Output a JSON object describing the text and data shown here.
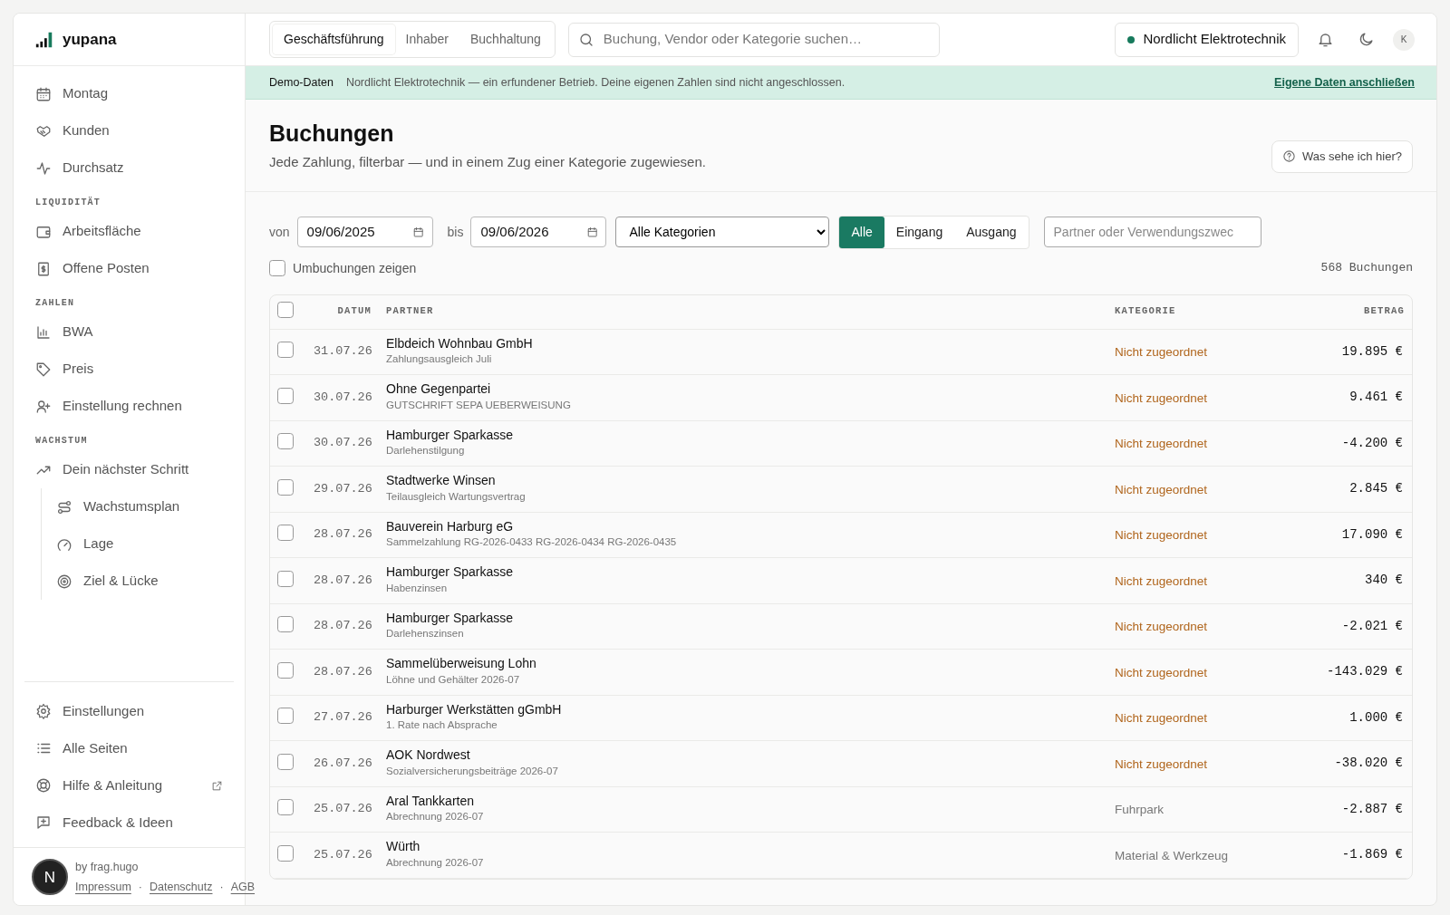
{
  "sidebar": {
    "logo": "yupana",
    "groups": [
      {
        "items": [
          {
            "label": "Montag"
          },
          {
            "label": "Kunden"
          },
          {
            "label": "Durchsatz"
          }
        ]
      },
      {
        "heading": "LIQUIDITÄT",
        "items": [
          {
            "label": "Arbeitsfläche"
          },
          {
            "label": "Offene Posten"
          }
        ]
      },
      {
        "heading": "ZAHLEN",
        "items": [
          {
            "label": "BWA"
          },
          {
            "label": "Preis"
          },
          {
            "label": "Einstellung rechnen"
          }
        ]
      },
      {
        "heading": "WACHSTUM",
        "items": [
          {
            "label": "Dein nächster Schritt",
            "children": [
              {
                "label": "Wachstumsplan"
              },
              {
                "label": "Lage"
              },
              {
                "label": "Ziel & Lücke"
              }
            ]
          }
        ]
      }
    ],
    "bottom_items": [
      {
        "label": "Einstellungen",
        "external": false
      },
      {
        "label": "Alle Seiten",
        "external": false
      },
      {
        "label": "Hilfe & Anleitung",
        "external": true
      },
      {
        "label": "Feedback & Ideen",
        "external": false
      }
    ],
    "credit": "by frag.hugo",
    "links": [
      {
        "label": "Impressum"
      },
      {
        "separator": "·",
        "label": "Datenschutz"
      },
      {
        "separator": "·",
        "label": "AGB"
      }
    ]
  },
  "dev_badge": "N",
  "topbar": {
    "role_tabs": [
      {
        "label": "Geschäftsführung",
        "selected": true
      },
      {
        "label": "Inhaber",
        "selected": false
      },
      {
        "label": "Buchhaltung",
        "selected": false
      }
    ],
    "search": {
      "placeholder": "Buchung, Vendor oder Kategorie suchen…"
    },
    "company": "Nordlicht Elektrotechnik",
    "avatar": "K"
  },
  "banner": {
    "label": "Demo-Daten",
    "text": "Nordlicht Elektrotechnik — ein erfundener Betrieb. Deine eigenen Zahlen sind nicht angeschlossen.",
    "link": "Eigene Daten anschließen"
  },
  "page": {
    "title": "Buchungen",
    "subtitle": "Jede Zahlung, filterbar — und in einem Zug einer Kategorie zugewiesen.",
    "help_button": "Was sehe ich hier?"
  },
  "filters": {
    "from_label": "von",
    "from": "09/06/2025",
    "to_label": "bis",
    "to": "09/06/2026",
    "category": "Alle Kategorien",
    "direction": [
      {
        "label": "Alle",
        "selected": true
      },
      {
        "label": "Eingang",
        "selected": false
      },
      {
        "label": "Ausgang",
        "selected": false
      }
    ],
    "search": {
      "placeholder": "Partner oder Verwendungszwec"
    },
    "show_transfers": {
      "label": "Umbuchungen zeigen",
      "checked": false
    },
    "count": "568 Buchungen"
  },
  "table": {
    "select_all": {
      "checked": false
    },
    "columns": [
      "DATUM",
      "PARTNER",
      "KATEGORIE",
      "BETRAG"
    ],
    "rows": [
      {
        "checked": false,
        "date": "31.07.26",
        "partner": "Elbdeich Wohnbau GmbH",
        "purpose": "Zahlungsausgleich Juli",
        "category": "Nicht zugeordnet",
        "assigned": false,
        "amount": "19.895 €"
      },
      {
        "checked": false,
        "date": "30.07.26",
        "partner": "Ohne Gegenpartei",
        "purpose": "GUTSCHRIFT SEPA UEBERWEISUNG",
        "category": "Nicht zugeordnet",
        "assigned": false,
        "amount": "9.461 €"
      },
      {
        "checked": false,
        "date": "30.07.26",
        "partner": "Hamburger Sparkasse",
        "purpose": "Darlehenstilgung",
        "category": "Nicht zugeordnet",
        "assigned": false,
        "amount": "-4.200 €"
      },
      {
        "checked": false,
        "date": "29.07.26",
        "partner": "Stadtwerke Winsen",
        "purpose": "Teilausgleich Wartungsvertrag",
        "category": "Nicht zugeordnet",
        "assigned": false,
        "amount": "2.845 €"
      },
      {
        "checked": false,
        "date": "28.07.26",
        "partner": "Bauverein Harburg eG",
        "purpose": "Sammelzahlung RG-2026-0433 RG-2026-0434 RG-2026-0435",
        "category": "Nicht zugeordnet",
        "assigned": false,
        "amount": "17.090 €"
      },
      {
        "checked": false,
        "date": "28.07.26",
        "partner": "Hamburger Sparkasse",
        "purpose": "Habenzinsen",
        "category": "Nicht zugeordnet",
        "assigned": false,
        "amount": "340 €"
      },
      {
        "checked": false,
        "date": "28.07.26",
        "partner": "Hamburger Sparkasse",
        "purpose": "Darlehenszinsen",
        "category": "Nicht zugeordnet",
        "assigned": false,
        "amount": "-2.021 €"
      },
      {
        "checked": false,
        "date": "28.07.26",
        "partner": "Sammelüberweisung Lohn",
        "purpose": "Löhne und Gehälter 2026-07",
        "category": "Nicht zugeordnet",
        "assigned": false,
        "amount": "-143.029 €"
      },
      {
        "checked": false,
        "date": "27.07.26",
        "partner": "Harburger Werkstätten gGmbH",
        "purpose": "1. Rate nach Absprache",
        "category": "Nicht zugeordnet",
        "assigned": false,
        "amount": "1.000 €"
      },
      {
        "checked": false,
        "date": "26.07.26",
        "partner": "AOK Nordwest",
        "purpose": "Sozialversicherungsbeiträge 2026-07",
        "category": "Nicht zugeordnet",
        "assigned": false,
        "amount": "-38.020 €"
      },
      {
        "checked": false,
        "date": "25.07.26",
        "partner": "Aral Tankkarten",
        "purpose": "Abrechnung 2026-07",
        "category": "Fuhrpark",
        "assigned": true,
        "amount": "-2.887 €"
      },
      {
        "checked": false,
        "date": "25.07.26",
        "partner": "Würth",
        "purpose": "Abrechnung 2026-07",
        "category": "Material & Werkzeug",
        "assigned": true,
        "amount": "-1.869 €"
      }
    ]
  }
}
